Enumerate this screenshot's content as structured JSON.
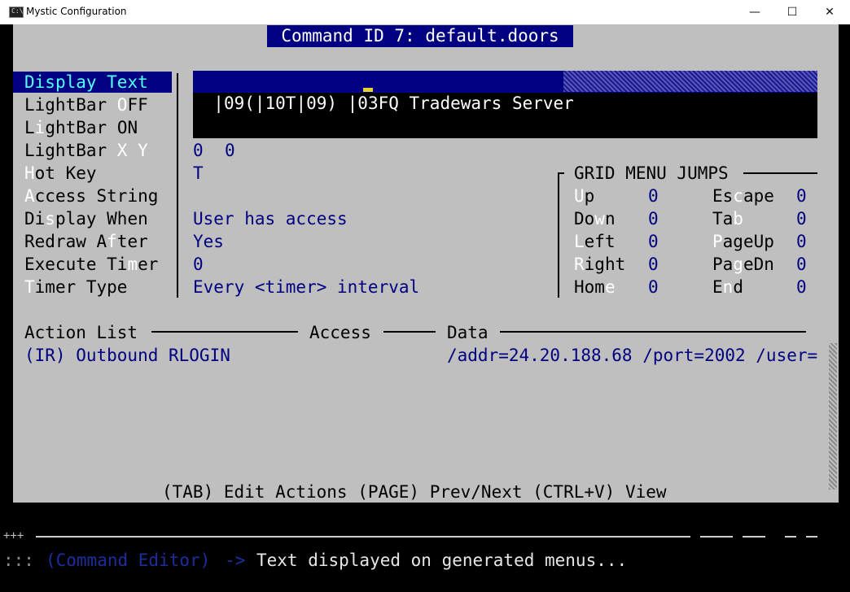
{
  "window": {
    "title": "Mystic Configuration",
    "icon_text": "C:\\",
    "minimize_glyph": "—",
    "maximize_glyph": "☐",
    "close_glyph": "✕"
  },
  "editor": {
    "header": "Command ID 7: default.doors",
    "fields": [
      {
        "pre": "",
        "hot": "D",
        "post": "isplay Text",
        "selected": true
      },
      {
        "pre": "LightBar ",
        "hot": "O",
        "post": "FF"
      },
      {
        "pre": "L",
        "hot": "i",
        "post": "ghtBar ON"
      },
      {
        "pre": "LightBar ",
        "hot": "X Y",
        "post": ""
      },
      {
        "pre": "",
        "hot": "H",
        "post": "ot Key"
      },
      {
        "pre": "",
        "hot": "A",
        "post": "ccess String"
      },
      {
        "pre": "Di",
        "hot": "s",
        "post": "play When"
      },
      {
        "pre": "Redraw A",
        "hot": "f",
        "post": "ter"
      },
      {
        "pre": "Execute Ti",
        "hot": "m",
        "post": "er"
      },
      {
        "pre": "",
        "hot": "T",
        "post": "imer Type"
      }
    ],
    "values": {
      "display_text": "|09(|10T|09) |03FQ Tradewars Server",
      "lightbar_x": "0",
      "lightbar_y": "0",
      "hot_key": "T",
      "access_string": "",
      "display_when": "User has access",
      "redraw_after": "Yes",
      "execute_timer": "0",
      "timer_type": "Every <timer> interval"
    },
    "grid_menu": {
      "title": "GRID MENU JUMPS",
      "items": [
        {
          "pre": "",
          "hot": "U",
          "post": "p",
          "value": "0"
        },
        {
          "pre": "Do",
          "hot": "w",
          "post": "n",
          "value": "0"
        },
        {
          "pre": "",
          "hot": "L",
          "post": "eft",
          "value": "0"
        },
        {
          "pre": "",
          "hot": "R",
          "post": "ight",
          "value": "0"
        },
        {
          "pre": "Hom",
          "hot": "e",
          "post": "",
          "value": "0"
        },
        {
          "pre": "Es",
          "hot": "c",
          "post": "ape",
          "value": "0"
        },
        {
          "pre": "Ta",
          "hot": "b",
          "post": "",
          "value": "0"
        },
        {
          "pre": "",
          "hot": "P",
          "post": "ageUp",
          "value": "0"
        },
        {
          "pre": "Pa",
          "hot": "g",
          "post": "eDn",
          "value": "0"
        },
        {
          "pre": "E",
          "hot": "n",
          "post": "d",
          "value": "0"
        }
      ]
    },
    "action_list": {
      "headers": {
        "action": "Action List",
        "access": "Access",
        "data": "Data"
      },
      "rows": [
        {
          "action": "(IR) Outbound RLOGIN",
          "access": "",
          "data": "/addr=24.20.188.68 /port=2002 /user="
        }
      ]
    },
    "footer": "(TAB) Edit Actions (PAGE) Prev/Next (CTRL+V) View"
  },
  "status_bar": {
    "corner": "+++",
    "prefix": ":::",
    "context": "(Command Editor)",
    "arrow": "->",
    "message": "Text displayed on generated menus..."
  },
  "colors": {
    "panel_gray": "#bfbfbf",
    "navy": "#000080",
    "cyan": "#55ffff",
    "white": "#ffffff"
  }
}
